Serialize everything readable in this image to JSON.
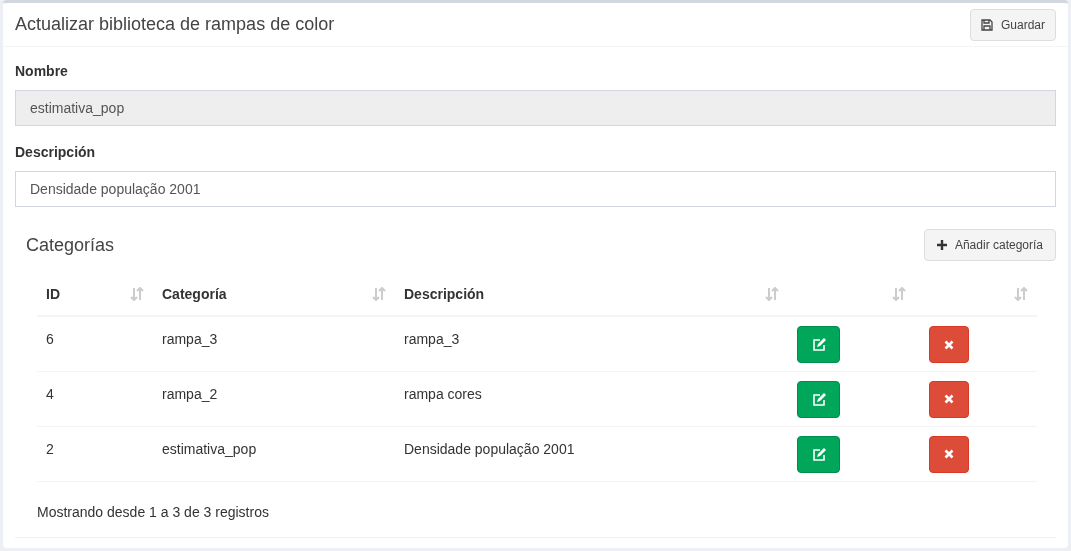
{
  "title": "Actualizar biblioteca de rampas de color",
  "save_button": "Guardar",
  "fields": [
    {
      "label": "Nombre",
      "value": "estimativa_pop",
      "disabled": true
    },
    {
      "label": "Descripción",
      "value": "Densidade população 2001",
      "disabled": false
    }
  ],
  "categories": {
    "title": "Categorías",
    "add_button": "Añadir categoría",
    "columns": [
      "ID",
      "Categoría",
      "Descripción",
      "",
      ""
    ],
    "rows": [
      {
        "id": "6",
        "category": "rampa_3",
        "description": "rampa_3"
      },
      {
        "id": "4",
        "category": "rampa_2",
        "description": "rampa cores"
      },
      {
        "id": "2",
        "category": "estimativa_pop",
        "description": "Densidade população 2001"
      }
    ],
    "footer": "Mostrando desde 1 a 3 de 3 registros"
  }
}
